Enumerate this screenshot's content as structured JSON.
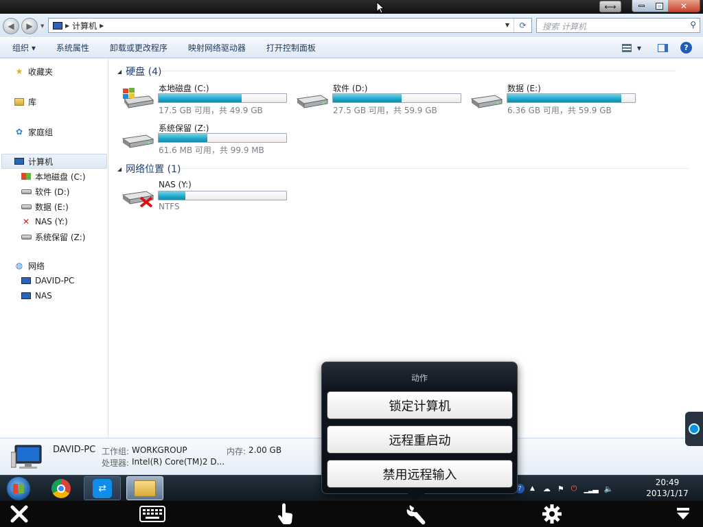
{
  "toolbar": {
    "search_placeholder": "搜索 计算机"
  },
  "address": {
    "root": "计算机"
  },
  "command_bar": [
    "组织 ▾",
    "系统属性",
    "卸载或更改程序",
    "映射网络驱动器",
    "打开控制面板"
  ],
  "nav": {
    "favorites": "收藏夹",
    "libraries": "库",
    "homegroup": "家庭组",
    "computer": "计算机",
    "drives": [
      "本地磁盘 (C:)",
      "软件 (D:)",
      "数据 (E:)",
      "NAS (Y:)",
      "系统保留 (Z:)"
    ],
    "network": "网络",
    "network_items": [
      "DAVID-PC",
      "NAS"
    ]
  },
  "groups": {
    "hdd": "硬盘 (4)",
    "net": "网络位置 (1)"
  },
  "drives": [
    {
      "name": "本地磁盘 (C:)",
      "info": "17.5 GB 可用，共 49.9 GB",
      "used_fraction": 0.65
    },
    {
      "name": "软件 (D:)",
      "info": "27.5 GB 可用，共 59.9 GB",
      "used_fraction": 0.54
    },
    {
      "name": "数据 (E:)",
      "info": "6.36 GB 可用，共 59.9 GB",
      "used_fraction": 0.89
    },
    {
      "name": "系统保留 (Z:)",
      "info": "61.6 MB 可用，共 99.9 MB",
      "used_fraction": 0.38
    },
    {
      "name": "NAS (Y:)",
      "info": "NTFS",
      "used_fraction": 0.21
    }
  ],
  "details": {
    "pc_name": "DAVID-PC",
    "workgroup_label": "工作组:",
    "workgroup": "WORKGROUP",
    "memory_label": "内存:",
    "memory": "2.00 GB",
    "cpu_label": "处理器:",
    "cpu": "Intel(R) Core(TM)2 D..."
  },
  "clock": {
    "time": "20:49",
    "date": "2013/1/17"
  },
  "popup": {
    "title": "动作",
    "buttons": [
      "锁定计算机",
      "远程重启动",
      "禁用远程输入"
    ]
  },
  "colors": {
    "accent": "#1ea6c7",
    "link": "#1e3d78"
  }
}
